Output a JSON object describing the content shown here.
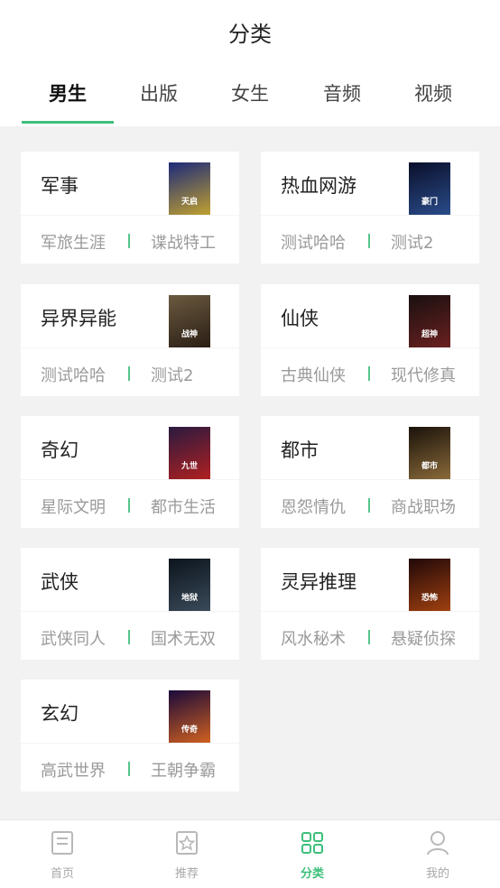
{
  "header": {
    "title": "分类",
    "tabs": [
      {
        "label": "男生",
        "active": true
      },
      {
        "label": "出版",
        "active": false
      },
      {
        "label": "女生",
        "active": false
      },
      {
        "label": "音频",
        "active": false
      },
      {
        "label": "视频",
        "active": false
      }
    ]
  },
  "categories": [
    {
      "name": "军事",
      "sub": [
        "军旅生涯",
        "谍战特工"
      ],
      "cover": {
        "text": "天启",
        "colors": [
          "#1c2a7a",
          "#c0a030"
        ]
      }
    },
    {
      "name": "热血网游",
      "sub": [
        "测试哈哈",
        "测试2"
      ],
      "cover": {
        "text": "豪门",
        "colors": [
          "#0a0f2a",
          "#2a4c8a"
        ]
      }
    },
    {
      "name": "异界异能",
      "sub": [
        "测试哈哈",
        "测试2"
      ],
      "cover": {
        "text": "战神",
        "colors": [
          "#6b5a40",
          "#2a1e14"
        ]
      }
    },
    {
      "name": "仙侠",
      "sub": [
        "古典仙侠",
        "现代修真"
      ],
      "cover": {
        "text": "超神",
        "colors": [
          "#1a1010",
          "#6a2020"
        ]
      }
    },
    {
      "name": "奇幻",
      "sub": [
        "星际文明",
        "都市生活"
      ],
      "cover": {
        "text": "九世",
        "colors": [
          "#2a1a40",
          "#b02020"
        ]
      }
    },
    {
      "name": "都市",
      "sub": [
        "恩怨情仇",
        "商战职场"
      ],
      "cover": {
        "text": "都市",
        "colors": [
          "#1a120a",
          "#8a6a3a"
        ]
      }
    },
    {
      "name": "武侠",
      "sub": [
        "武侠同人",
        "国术无双"
      ],
      "cover": {
        "text": "地狱",
        "colors": [
          "#0c141c",
          "#3a4a5a"
        ]
      }
    },
    {
      "name": "灵异推理",
      "sub": [
        "风水秘术",
        "悬疑侦探"
      ],
      "cover": {
        "text": "恐怖",
        "colors": [
          "#200808",
          "#a04010"
        ]
      }
    },
    {
      "name": "玄幻",
      "sub": [
        "高武世界",
        "王朝争霸"
      ],
      "cover": {
        "text": "传奇",
        "colors": [
          "#1a0a3a",
          "#d06020"
        ]
      }
    }
  ],
  "tabbar": [
    {
      "label": "首页",
      "icon": "book-icon",
      "active": false
    },
    {
      "label": "推荐",
      "icon": "star-icon",
      "active": false
    },
    {
      "label": "分类",
      "icon": "grid-icon",
      "active": true
    },
    {
      "label": "我的",
      "icon": "user-icon",
      "active": false
    }
  ],
  "colors": {
    "accent": "#3dbf7a",
    "background": "#f2f2f2",
    "card": "#ffffff"
  }
}
